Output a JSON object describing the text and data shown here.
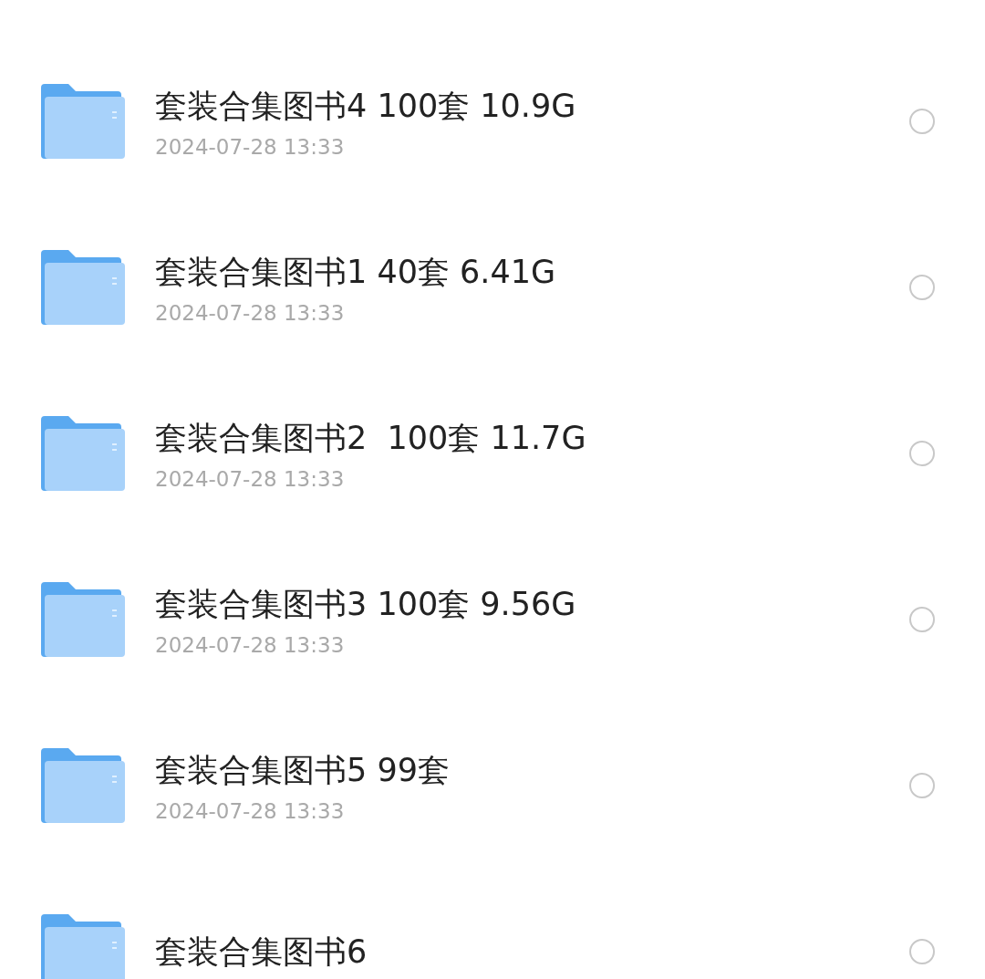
{
  "folders": [
    {
      "name": "套装合集图书4 100套 10.9G",
      "date": "2024-07-28 13:33",
      "selected": false
    },
    {
      "name": "套装合集图书1 40套 6.41G",
      "date": "2024-07-28 13:33",
      "selected": false
    },
    {
      "name": "套装合集图书2  100套 11.7G",
      "date": "2024-07-28 13:33",
      "selected": false
    },
    {
      "name": "套装合集图书3 100套 9.56G",
      "date": "2024-07-28 13:33",
      "selected": false
    },
    {
      "name": "套装合集图书5 99套",
      "date": "2024-07-28 13:33",
      "selected": false
    },
    {
      "name": "套装合集图书6",
      "selected": false
    }
  ]
}
